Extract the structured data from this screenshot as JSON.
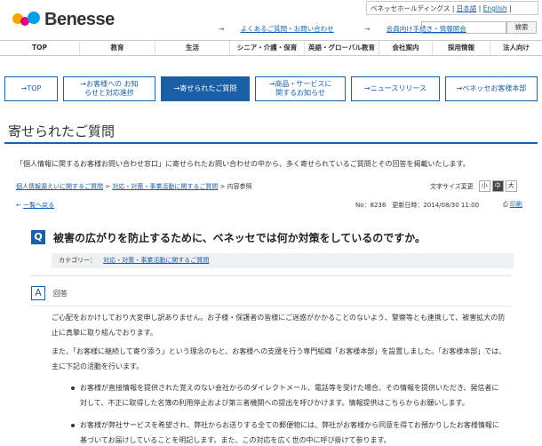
{
  "header": {
    "logo_text": "Benesse",
    "corp_label": "ベネッセホールディングス",
    "lang_ja": "日本語",
    "lang_en": "English",
    "faq_link": "よくあるご質問・お問い合わせ",
    "member_link": "会員向け手続き・情報照会",
    "search_button": "検索"
  },
  "global_nav": [
    "TOP",
    "教育",
    "生活",
    "シニア・介護・保育",
    "英語・グローバル教育",
    "会社案内",
    "採用情報",
    "法人向け"
  ],
  "sub_nav": [
    {
      "label": "→TOP",
      "active": false
    },
    {
      "label": "→お客様への お知らせと対応進捗",
      "active": false
    },
    {
      "label": "→寄せられたご質問",
      "active": true
    },
    {
      "label": "→商品・サービスに 関するお知らせ",
      "active": false
    },
    {
      "label": "→ニュースリリース",
      "active": false
    },
    {
      "label": "→ベネッセお客様本部",
      "active": false
    }
  ],
  "page": {
    "title": "寄せられたご質問",
    "intro": "「個人情報に関するお客様お問い合わせ窓口」に寄せられたお問い合わせの中から、多く寄せられているご質問とその回答を掲載いたします。",
    "breadcrumb": [
      "個人情報漏えいに関するご質問",
      "対応・対策・事業活動に関するご質問",
      "内容参照"
    ],
    "fontsize_label": "文字サイズ変更",
    "fontsize_options": [
      "小",
      "中",
      "大"
    ],
    "back_link": "一覧へ戻る",
    "meta": "No：8236　更新日時：2014/08/30 11:00",
    "print_label": "印刷"
  },
  "question": {
    "badge": "Q",
    "text": "被害の広がりを防止するために、ベネッセでは何か対策をしているのですか。",
    "category_label": "カテゴリー：",
    "category_value": "対応・対策・事業活動に関するご質問"
  },
  "answer": {
    "badge": "A",
    "label": "回答",
    "p1": "ご心配をおかけしており大変申し訳ありません。お子様・保護者の皆様にご迷惑がかかることのないよう、警察等とも連携して、被害拡大の防止に真摯に取り組んでおります。",
    "p2": "また、「お客様に継続して寄り添う」という理念のもと、お客様への支援を行う専門組織「お客様本部」を設置しました。「お客様本部」では、主に下記の活動を行います。",
    "bullet1": "お客様が直接情報を提供された覚えのない会社からのダイレクトメール、電話等を受けた場合、その情報を提供いただき、発信者に対して、不正に取得した名簿の利用停止および第三者機関への提出を呼びかけます。情報提供はこちらからお願いします。",
    "bullet2": "お客様が弊社サービスを希望され、弊社からお送りする全ての郵便物には、弊社がお客様から同意を得てお預かりしたお客様情報に基づいてお届けしていることを明記します。また、この対応を広く世の中に呼び掛けて参ります。"
  }
}
